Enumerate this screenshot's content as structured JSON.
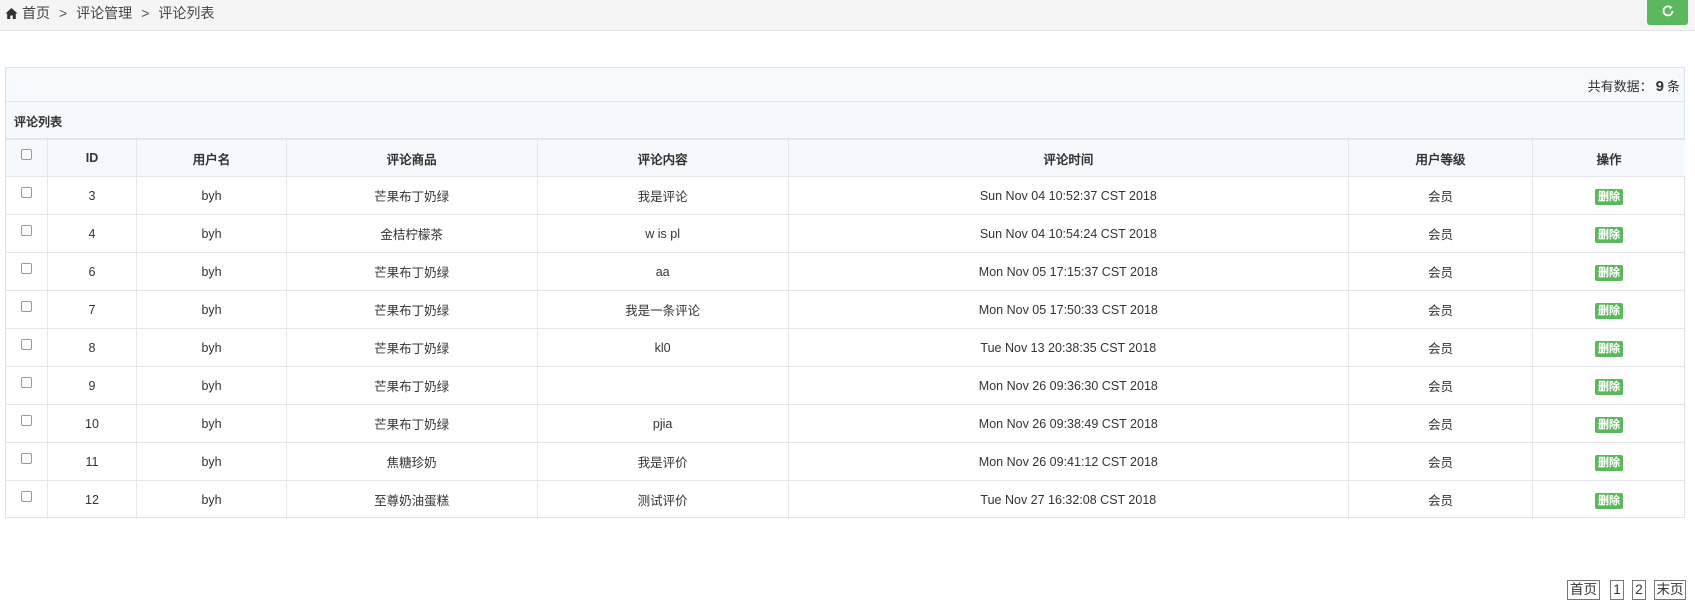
{
  "breadcrumb": {
    "items": [
      "首页",
      "评论管理",
      "评论列表"
    ],
    "separator": ">"
  },
  "icons": {
    "home": "home-icon",
    "refresh": "refresh-icon"
  },
  "colors": {
    "accent": "#5cb85c"
  },
  "summary": {
    "prefix": "共有数据：",
    "count": "9",
    "suffix": "条"
  },
  "panel": {
    "title": "评论列表"
  },
  "table": {
    "headers": [
      "ID",
      "用户名",
      "评论商品",
      "评论内容",
      "评论时间",
      "用户等级",
      "操作"
    ],
    "rows": [
      {
        "id": "3",
        "user": "byh",
        "product": "芒果布丁奶绿",
        "content": "我是评论",
        "time": "Sun Nov 04 10:52:37 CST 2018",
        "level": "会员",
        "action": "删除"
      },
      {
        "id": "4",
        "user": "byh",
        "product": "金桔柠檬茶",
        "content": "w is pl",
        "time": "Sun Nov 04 10:54:24 CST 2018",
        "level": "会员",
        "action": "删除"
      },
      {
        "id": "6",
        "user": "byh",
        "product": "芒果布丁奶绿",
        "content": "aa",
        "time": "Mon Nov 05 17:15:37 CST 2018",
        "level": "会员",
        "action": "删除"
      },
      {
        "id": "7",
        "user": "byh",
        "product": "芒果布丁奶绿",
        "content": "我是一条评论",
        "time": "Mon Nov 05 17:50:33 CST 2018",
        "level": "会员",
        "action": "删除"
      },
      {
        "id": "8",
        "user": "byh",
        "product": "芒果布丁奶绿",
        "content": "kl0",
        "time": "Tue Nov 13 20:38:35 CST 2018",
        "level": "会员",
        "action": "删除"
      },
      {
        "id": "9",
        "user": "byh",
        "product": "芒果布丁奶绿",
        "content": "",
        "time": "Mon Nov 26 09:36:30 CST 2018",
        "level": "会员",
        "action": "删除"
      },
      {
        "id": "10",
        "user": "byh",
        "product": "芒果布丁奶绿",
        "content": "pjia",
        "time": "Mon Nov 26 09:38:49 CST 2018",
        "level": "会员",
        "action": "删除"
      },
      {
        "id": "11",
        "user": "byh",
        "product": "焦糖珍奶",
        "content": "我是评价",
        "time": "Mon Nov 26 09:41:12 CST 2018",
        "level": "会员",
        "action": "删除"
      },
      {
        "id": "12",
        "user": "byh",
        "product": "至尊奶油蛋糕",
        "content": "测试评价",
        "time": "Tue Nov 27 16:32:08 CST 2018",
        "level": "会员",
        "action": "删除"
      }
    ]
  },
  "pagination": {
    "first": "首页",
    "pages": [
      "1",
      "2"
    ],
    "last": "末页"
  }
}
